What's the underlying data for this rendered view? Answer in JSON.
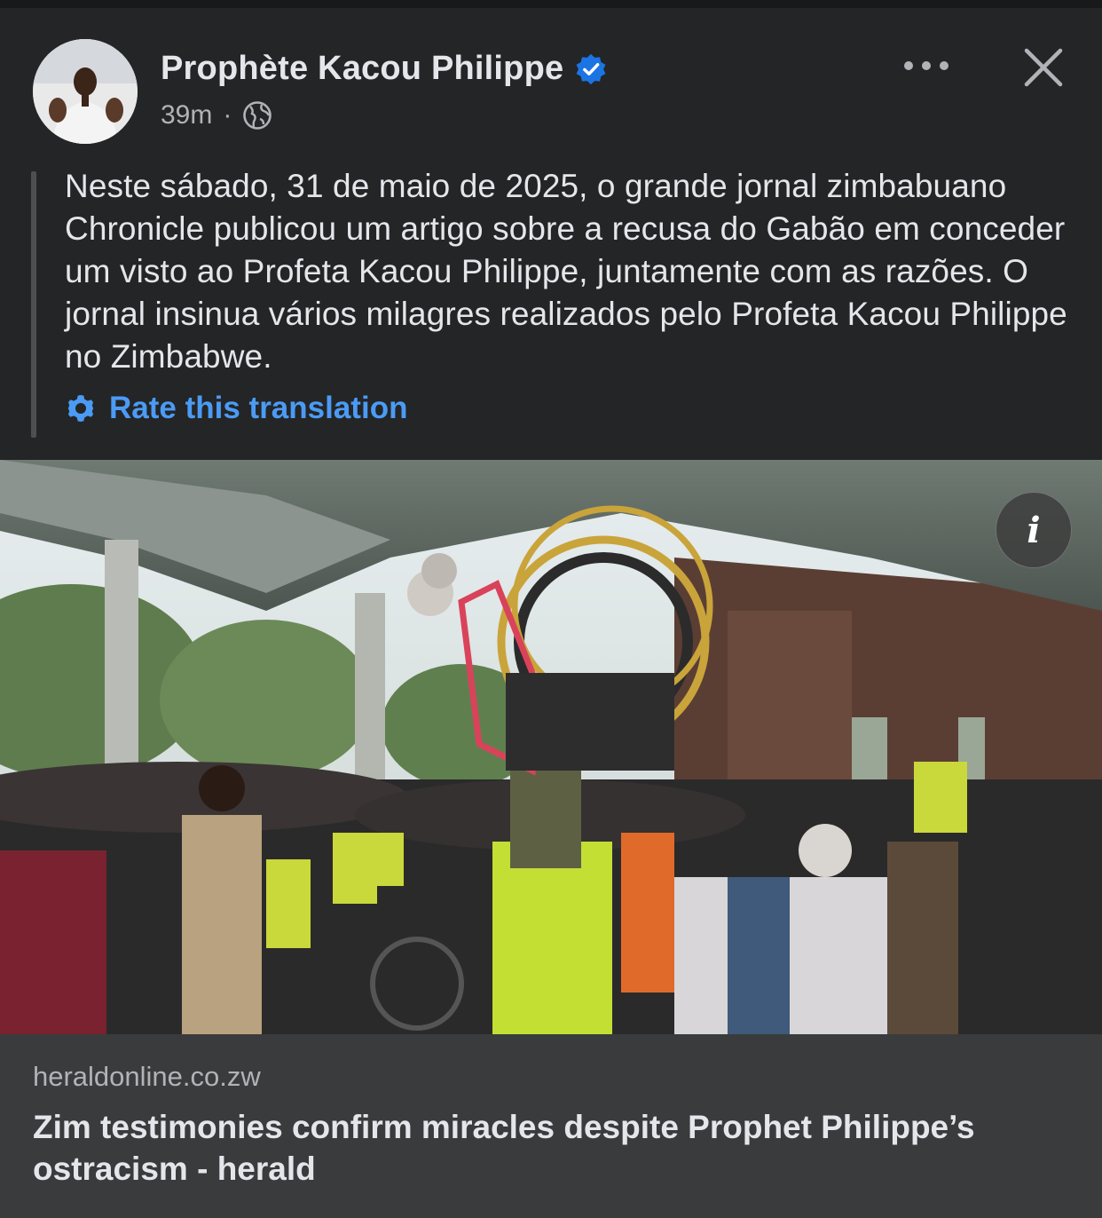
{
  "post": {
    "author_name": "Prophète Kacou Philippe",
    "verified": true,
    "timestamp": "39m",
    "separator": "·",
    "audience_icon": "globe-icon",
    "text": "Neste sábado, 31 de maio de 2025, o grande jornal zimbabuano Chronicle publicou um artigo sobre a recusa do Gabão em conceder um visto ao Profeta Kacou Philippe, juntamente com as razões. O jornal insinua vários milagres realizados pelo Profeta Kacou Philippe no Zimbabwe.",
    "rate_translation_label": "Rate this translation"
  },
  "header_actions": {
    "more_icon": "more-options-icon",
    "close_icon": "close-icon"
  },
  "photo": {
    "info_label": "i"
  },
  "link_preview": {
    "domain": "heraldonline.co.zw",
    "title": "Zim testimonies confirm miracles despite Prophet Philippe’s ostracism - herald"
  },
  "colors": {
    "background": "#242526",
    "text_primary": "#e4e6eb",
    "text_secondary": "#b0b3b8",
    "accent_blue": "#4b9bf5",
    "verified_blue": "#1b74e4",
    "link_card_bg": "#3a3b3c"
  }
}
